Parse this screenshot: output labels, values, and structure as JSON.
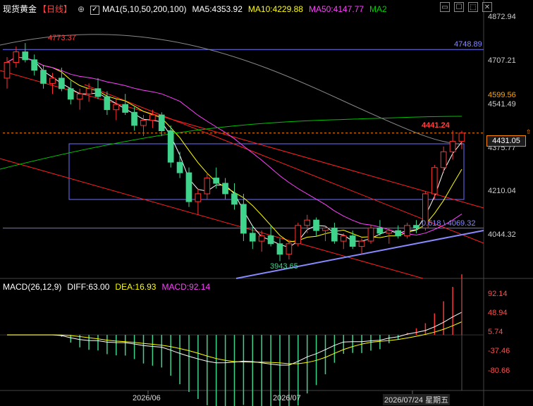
{
  "header": {
    "symbol": "现货黄金",
    "period": "【日线】",
    "crosshair_icon": "target-icon",
    "ma_label": "MA1(5,10,50,200,100)",
    "ma5": "MA5:4353.92",
    "ma10": "MA10:4229.88",
    "ma50": "MA50:4147.77",
    "ma2": "MA2",
    "toolbar_icons": [
      "window-icon",
      "checkbox-icon",
      "maximize-icon",
      "close-icon"
    ]
  },
  "macd_header": {
    "label": "MACD(26,12,9)",
    "diff": "DIFF:63.00",
    "dea": "DEA:16.93",
    "macd": "MACD:92.14"
  },
  "price_axis": [
    "4872.94",
    "4707.21",
    "4599.56",
    "4541.49",
    "4375.77",
    "4210.04",
    "4044.32"
  ],
  "current_price": "4431.05",
  "macd_axis": [
    "92.14",
    "48.94",
    "5.74",
    "-37.46",
    "-80.66"
  ],
  "dates": [
    "2026/06",
    "2026/07",
    "2026/07/24 星期五"
  ],
  "annotations": {
    "high_price": "4773.37",
    "line_level": "4748.89",
    "recent_high": "4441.24",
    "low_price": "3943.65",
    "fib_label": "0.618",
    "fib_value": "4069.32"
  },
  "colors": {
    "up": "#ff3232",
    "down": "#3fd38c",
    "ma5": "#ffffff",
    "ma10": "#ffff00",
    "ma50": "#ff40ff",
    "ma_long": "#00c000",
    "ma_gray": "#888888",
    "channel": "#ff2020",
    "box": "#7070ff",
    "dashed": "#ff8c00"
  },
  "chart_data": {
    "type": "candlestick",
    "candles": [
      [
        4640,
        4720,
        4600,
        4700
      ],
      [
        4700,
        4760,
        4680,
        4740
      ],
      [
        4740,
        4773.37,
        4700,
        4710
      ],
      [
        4710,
        4730,
        4650,
        4670
      ],
      [
        4670,
        4690,
        4600,
        4620
      ],
      [
        4620,
        4660,
        4580,
        4640
      ],
      [
        4640,
        4680,
        4590,
        4600
      ],
      [
        4600,
        4630,
        4540,
        4560
      ],
      [
        4560,
        4600,
        4520,
        4580
      ],
      [
        4580,
        4620,
        4550,
        4600
      ],
      [
        4600,
        4640,
        4560,
        4570
      ],
      [
        4570,
        4590,
        4500,
        4520
      ],
      [
        4520,
        4560,
        4480,
        4540
      ],
      [
        4540,
        4580,
        4500,
        4510
      ],
      [
        4510,
        4530,
        4440,
        4460
      ],
      [
        4460,
        4500,
        4420,
        4480
      ],
      [
        4480,
        4520,
        4450,
        4500
      ],
      [
        4500,
        4510,
        4420,
        4440
      ],
      [
        4440,
        4460,
        4300,
        4320
      ],
      [
        4320,
        4360,
        4260,
        4280
      ],
      [
        4280,
        4300,
        4150,
        4170
      ],
      [
        4170,
        4220,
        4120,
        4200
      ],
      [
        4200,
        4280,
        4180,
        4260
      ],
      [
        4260,
        4300,
        4220,
        4240
      ],
      [
        4240,
        4260,
        4180,
        4200
      ],
      [
        4200,
        4240,
        4140,
        4160
      ],
      [
        4160,
        4200,
        4020,
        4050
      ],
      [
        4050,
        4080,
        3990,
        4020
      ],
      [
        4020,
        4060,
        3980,
        4040
      ],
      [
        4040,
        4080,
        4000,
        4010
      ],
      [
        4010,
        4030,
        3943.65,
        3970
      ],
      [
        3970,
        4020,
        3950,
        4010
      ],
      [
        4010,
        4090,
        4000,
        4080
      ],
      [
        4080,
        4120,
        4050,
        4100
      ],
      [
        4100,
        4110,
        4040,
        4060
      ],
      [
        4060,
        4080,
        4020,
        4070
      ],
      [
        4070,
        4090,
        4010,
        4020
      ],
      [
        4020,
        4050,
        3990,
        4040
      ],
      [
        4040,
        4060,
        3990,
        4000
      ],
      [
        4000,
        4030,
        3970,
        4020
      ],
      [
        4020,
        4080,
        4010,
        4070
      ],
      [
        4070,
        4100,
        4040,
        4050
      ],
      [
        4050,
        4070,
        4010,
        4060
      ],
      [
        4060,
        4080,
        4030,
        4040
      ],
      [
        4040,
        4090,
        4030,
        4080
      ],
      [
        4080,
        4100,
        4050,
        4070
      ],
      [
        4070,
        4210,
        4060,
        4200
      ],
      [
        4200,
        4310,
        4180,
        4300
      ],
      [
        4300,
        4380,
        4280,
        4360
      ],
      [
        4360,
        4441.24,
        4330,
        4400
      ],
      [
        4400,
        4440,
        4370,
        4431.05
      ]
    ]
  }
}
